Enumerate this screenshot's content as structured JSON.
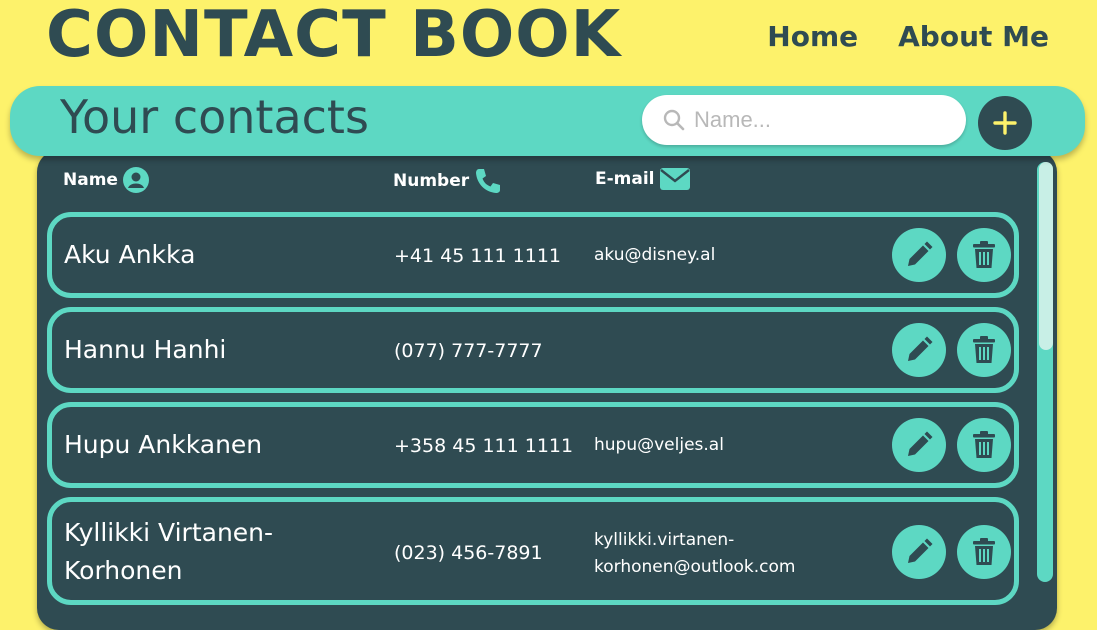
{
  "app": {
    "brand": "CONTACT BOOK",
    "nav": {
      "home": "Home",
      "about": "About Me"
    }
  },
  "header": {
    "title": "Your contacts",
    "search": {
      "placeholder": "Name...",
      "value": ""
    },
    "add_label": "+"
  },
  "columns": {
    "name": "Name",
    "number": "Number",
    "email": "E-mail"
  },
  "contacts": [
    {
      "name": "Aku Ankka",
      "number": "+41 45 111 1111",
      "email": "aku@disney.al"
    },
    {
      "name": "Hannu Hanhi",
      "number": "(077) 777-7777",
      "email": ""
    },
    {
      "name": "Hupu Ankkanen",
      "number": "+358 45 111 1111",
      "email": "hupu@veljes.al"
    },
    {
      "name_line1": "Kyllikki Virtanen-",
      "name_line2": "Korhonen",
      "number": "(023) 456-7891",
      "email_line1": "kyllikki.virtanen-",
      "email_line2": "korhonen@outlook.com"
    }
  ],
  "colors": {
    "background": "#fdf26b",
    "accent": "#5dd8c3",
    "dark": "#2f4b52"
  }
}
